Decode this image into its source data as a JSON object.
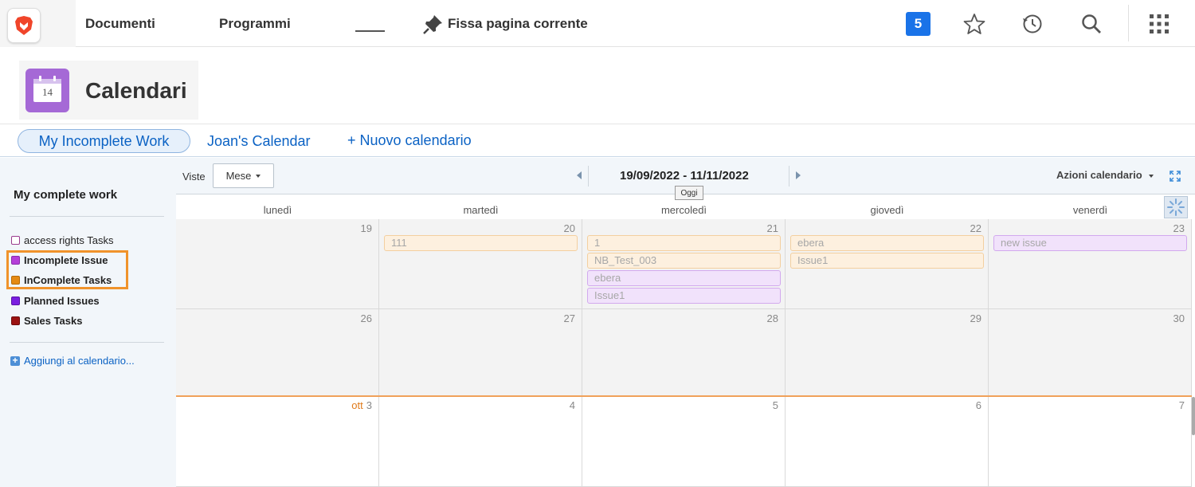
{
  "topbar": {
    "nav": [
      "Documenti",
      "Programmi"
    ],
    "pin_label": "Fissa pagina corrente",
    "badge_count": "5"
  },
  "page": {
    "title": "Calendari",
    "calendar_icon_day": "14"
  },
  "tabs": {
    "active": "My Incomplete Work",
    "other": "Joan's Calendar",
    "new": "+ Nuovo calendario"
  },
  "sidebar": {
    "title": "My complete work",
    "items": [
      {
        "label": "access rights Tasks",
        "color": "#ffffff",
        "border": "#9a3c8e",
        "bold": false
      },
      {
        "label": "Incomplete Issue",
        "color": "#b53fd9",
        "border": "#8a2cab",
        "bold": true
      },
      {
        "label": "InComplete Tasks",
        "color": "#e58a13",
        "border": "#b46a0a",
        "bold": true
      },
      {
        "label": "Planned Issues",
        "color": "#7a1fe0",
        "border": "#5a12a8",
        "bold": true
      },
      {
        "label": "Sales Tasks",
        "color": "#9b1212",
        "border": "#6e0b0b",
        "bold": true
      }
    ],
    "add_label": "Aggiungi al calendario..."
  },
  "toolbar": {
    "views_label": "Viste",
    "view_value": "Mese",
    "date_range": "19/09/2022 - 11/11/2022",
    "today_tooltip": "Oggi",
    "actions_label": "Azioni calendario"
  },
  "calendar": {
    "days": [
      "lunedì",
      "martedì",
      "mercoledì",
      "giovedì",
      "venerdì"
    ],
    "weeks": [
      [
        {
          "num": "19",
          "events": []
        },
        {
          "num": "20",
          "events": [
            {
              "label": "111",
              "kind": "orange"
            }
          ]
        },
        {
          "num": "21",
          "events": [
            {
              "label": "1",
              "kind": "orange"
            },
            {
              "label": "NB_Test_003",
              "kind": "orange"
            },
            {
              "label": "ebera",
              "kind": "purple"
            },
            {
              "label": "Issue1",
              "kind": "purple"
            }
          ]
        },
        {
          "num": "22",
          "events": [
            {
              "label": "ebera",
              "kind": "orange"
            },
            {
              "label": "Issue1",
              "kind": "orange"
            }
          ]
        },
        {
          "num": "23",
          "events": [
            {
              "label": "new issue",
              "kind": "purple"
            }
          ]
        }
      ],
      [
        {
          "num": "26",
          "events": []
        },
        {
          "num": "27",
          "events": []
        },
        {
          "num": "28",
          "events": []
        },
        {
          "num": "29",
          "events": []
        },
        {
          "num": "30",
          "events": []
        }
      ],
      [
        {
          "num": "3",
          "month": "ott",
          "events": []
        },
        {
          "num": "4",
          "events": []
        },
        {
          "num": "5",
          "events": []
        },
        {
          "num": "6",
          "events": []
        },
        {
          "num": "7",
          "events": []
        }
      ]
    ],
    "colors": {
      "orange_bg": "#fdf0df",
      "purple_bg": "#f1e2fb",
      "today_line": "#f0a15a"
    }
  }
}
